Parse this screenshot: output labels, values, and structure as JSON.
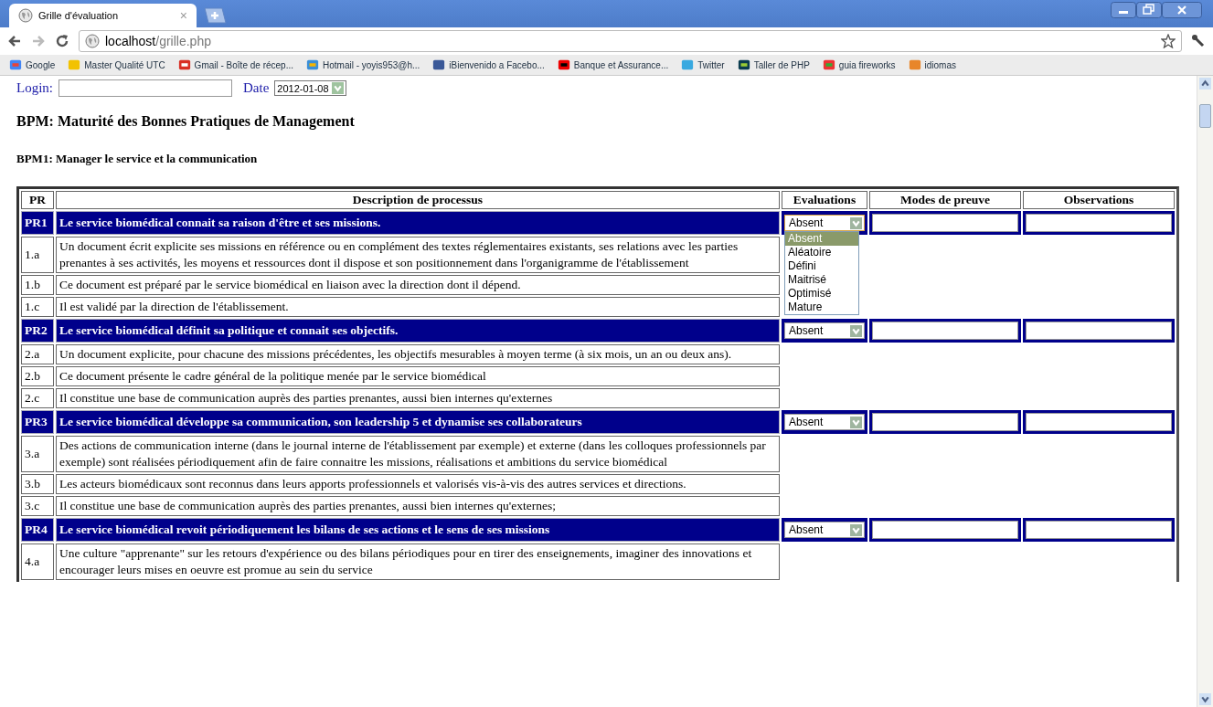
{
  "browser": {
    "tab": {
      "title": "Grille d'évaluation",
      "close": "×"
    },
    "url": {
      "host": "localhost",
      "path": "/grille.php"
    },
    "bookmarks": [
      "Google",
      "Master Qualité UTC",
      "Gmail - Boîte de récep...",
      "Hotmail - yoyis953@h...",
      "iBienvenido a Facebo...",
      "Banque et Assurance...",
      "Twitter",
      "Taller de PHP",
      "guia fireworks",
      "idiomas"
    ]
  },
  "form": {
    "login_label": "Login:",
    "date_label": "Date",
    "date_value": "2012-01-08"
  },
  "heading": "BPM: Maturité des Bonnes Pratiques de Management",
  "subheading": "BPM1: Manager le service et la communication",
  "table": {
    "columns": [
      "PR",
      "Description de processus",
      "Evaluations",
      "Modes de preuve",
      "Observations"
    ],
    "sections": [
      {
        "code": "PR1",
        "title": "Le service biomédical connait sa raison d'être et ses missions.",
        "evaluation": {
          "value": "Absent",
          "expanded": true,
          "options": [
            {
              "label": "Absent",
              "selected": true
            },
            {
              "label": "Aléatoire",
              "selected": false
            },
            {
              "label": "Défini",
              "selected": false
            },
            {
              "label": "Maitrisé",
              "selected": false
            },
            {
              "label": "Optimisé",
              "selected": false
            },
            {
              "label": "Mature",
              "selected": false
            }
          ]
        },
        "items": [
          {
            "code": "1.a",
            "text": "Un document écrit explicite ses missions en référence ou en complément des textes réglementaires existants, ses relations avec les parties prenantes à ses activités, les moyens et ressources dont il dispose et son positionnement dans l'organigramme de l'établissement"
          },
          {
            "code": "1.b",
            "text": "Ce document est préparé par le service biomédical en liaison avec la direction dont il dépend."
          },
          {
            "code": "1.c",
            "text": "Il est validé par la direction de l'établissement."
          }
        ]
      },
      {
        "code": "PR2",
        "title": "Le service biomédical définit sa politique et connait ses objectifs.",
        "evaluation": {
          "value": "Absent",
          "expanded": false
        },
        "items": [
          {
            "code": "2.a",
            "text": "Un document explicite, pour chacune des missions précédentes, les objectifs mesurables à moyen terme (à six mois, un an ou deux ans)."
          },
          {
            "code": "2.b",
            "text": "Ce document présente le cadre général de la politique menée par le service biomédical"
          },
          {
            "code": "2.c",
            "text": "Il constitue une base de communication auprès des parties prenantes, aussi bien internes qu'externes"
          }
        ]
      },
      {
        "code": "PR3",
        "title": "Le service biomédical développe sa communication, son leadership 5 et dynamise ses collaborateurs",
        "evaluation": {
          "value": "Absent",
          "expanded": false
        },
        "items": [
          {
            "code": "3.a",
            "text": "Des actions de communication interne (dans le journal interne de l'établissement par exemple) et externe (dans les colloques professionnels par exemple) sont réalisées périodiquement afin de faire connaitre les missions, réalisations et ambitions du service biomédical"
          },
          {
            "code": "3.b",
            "text": "Les acteurs biomédicaux sont reconnus dans leurs apports professionnels et valorisés vis-à-vis des autres services et directions."
          },
          {
            "code": "3.c",
            "text": "Il constitue une base de communication auprès des parties prenantes, aussi bien internes qu'externes;"
          }
        ]
      },
      {
        "code": "PR4",
        "title": "Le service biomédical revoit périodiquement les bilans de ses actions et le sens de ses missions",
        "evaluation": {
          "value": "Absent",
          "expanded": false
        },
        "items": [
          {
            "code": "4.a",
            "text": "Une culture \"apprenante\" sur les retours d'expérience ou des bilans périodiques pour en tirer des enseignements, imaginer des innovations et encourager leurs mises en oeuvre est promue au sein du service"
          }
        ]
      }
    ]
  }
}
